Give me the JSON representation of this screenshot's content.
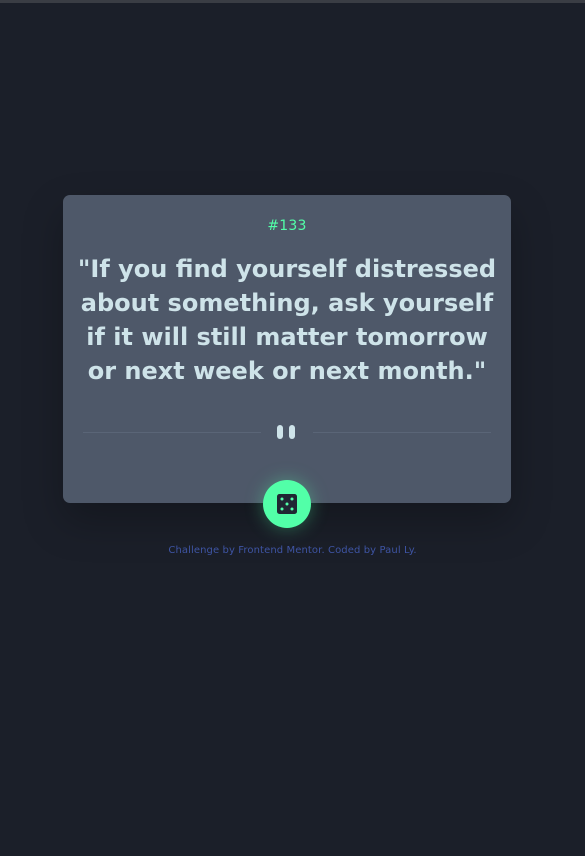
{
  "advice": {
    "id_label": "#133",
    "quote": "\"If you find yourself distressed about something, ask yourself if it will still matter tomorrow or next week or next month.\""
  },
  "icons": {
    "divider": "pause-icon",
    "button": "dice-icon"
  },
  "attribution": {
    "prefix": "Challenge by",
    "frontend_mentor": "Frontend Mentor",
    "middle": ". Coded by",
    "author": "Paul Ly",
    "suffix": "."
  },
  "colors": {
    "background": "#1b1f29",
    "card": "#4e5869",
    "accent": "#52ffa8",
    "text": "#cee3e9",
    "link": "#3e54a3"
  }
}
